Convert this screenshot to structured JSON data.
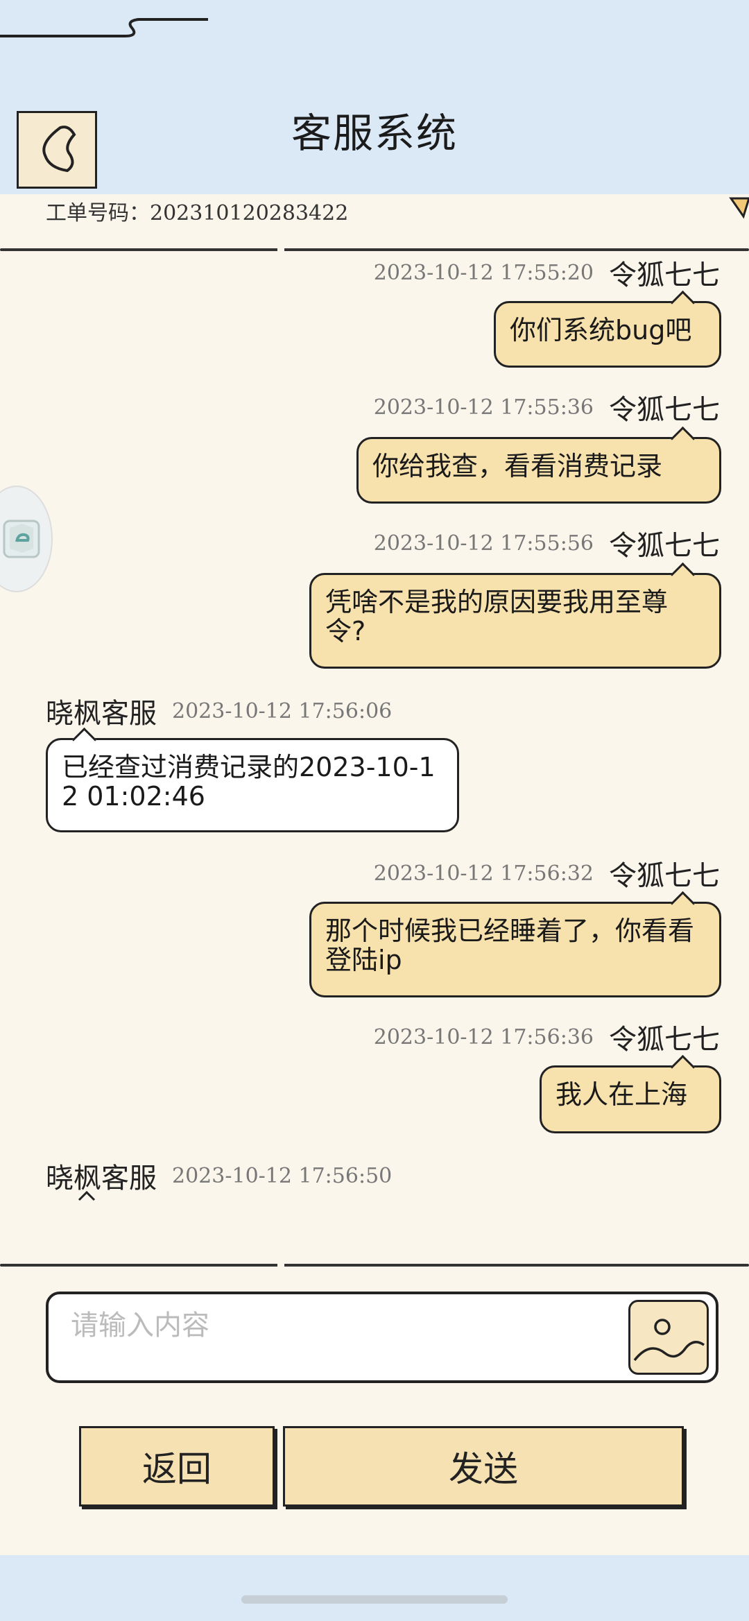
{
  "header": {
    "title": "客服系统"
  },
  "ticket": {
    "label": "工单号码：",
    "number": "202310120283422"
  },
  "messages": [
    {
      "from": "me",
      "name": "令狐七七",
      "time": "2023-10-12 17:55:20",
      "text": "你们系统bug吧"
    },
    {
      "from": "me",
      "name": "令狐七七",
      "time": "2023-10-12 17:55:36",
      "text": "你给我查，看看消费记录"
    },
    {
      "from": "me",
      "name": "令狐七七",
      "time": "2023-10-12 17:55:56",
      "text": "凭啥不是我的原因要我用至尊令?"
    },
    {
      "from": "them",
      "name": "晓枫客服",
      "time": "2023-10-12 17:56:06",
      "text": "已经查过消费记录的2023-10-12 01:02:46"
    },
    {
      "from": "me",
      "name": "令狐七七",
      "time": "2023-10-12 17:56:32",
      "text": "那个时候我已经睡着了，你看看登陆ip"
    },
    {
      "from": "me",
      "name": "令狐七七",
      "time": "2023-10-12 17:56:36",
      "text": "我人在上海"
    },
    {
      "from": "them",
      "name": "晓枫客服",
      "time": "2023-10-12 17:56:50",
      "text": ""
    }
  ],
  "input": {
    "placeholder": "请输入内容"
  },
  "buttons": {
    "back": "返回",
    "send": "发送"
  },
  "colors": {
    "header_bg": "#dbe8f5",
    "page_bg": "#fbf6ec",
    "my_bubble": "#f7e1ad",
    "agent_bubble": "#ffffff",
    "button_bg": "#f6e1b2"
  }
}
